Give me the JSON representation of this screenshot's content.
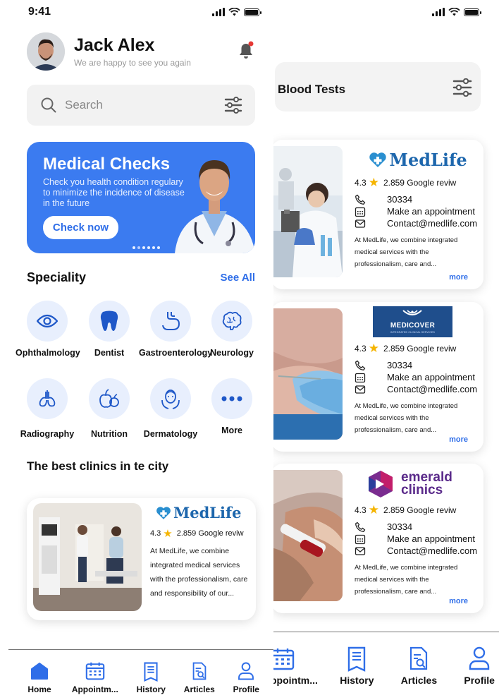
{
  "status": {
    "time": "9:41"
  },
  "user": {
    "name": "Jack Alex",
    "greeting": "We are happy to see you again"
  },
  "search": {
    "placeholder": "Search"
  },
  "banner": {
    "title": "Medical Checks",
    "text": "Check you health condition regulary to minimize the incidence of disease in the future",
    "button": "Check now",
    "dots_total": 6,
    "dots_active": 2
  },
  "speciality": {
    "title": "Speciality",
    "see_all": "See All",
    "items": [
      {
        "label": "Ophthalmology",
        "icon": "eye-icon"
      },
      {
        "label": "Dentist",
        "icon": "tooth-icon"
      },
      {
        "label": "Gastroenterology",
        "icon": "stomach-icon"
      },
      {
        "label": "Neurology",
        "icon": "brain-icon"
      },
      {
        "label": "Radiography",
        "icon": "lungs-icon"
      },
      {
        "label": "Nutrition",
        "icon": "fruit-icon"
      },
      {
        "label": "Dermatology",
        "icon": "face-skin-icon"
      },
      {
        "label": "More",
        "icon": "more-icon"
      }
    ]
  },
  "best_clinics": {
    "title": "The best clinics in te city",
    "card": {
      "name": "MedLife",
      "rating": "4.3",
      "reviews": "2.859 Google reviw",
      "description": "At MedLife, we combine integrated medical services with the professionalism, care and responsibility of our..."
    }
  },
  "nav_left": [
    {
      "label": "Home",
      "icon": "home-icon",
      "active": true
    },
    {
      "label": "Appointm...",
      "icon": "calendar-icon"
    },
    {
      "label": "History",
      "icon": "history-icon"
    },
    {
      "label": "Articles",
      "icon": "articles-icon"
    },
    {
      "label": "Profile",
      "icon": "profile-icon"
    }
  ],
  "blood_tests": {
    "title": "Blood Tests",
    "clinics": [
      {
        "name": "MedLife",
        "rating": "4.3",
        "reviews": "2.859 Google reviw",
        "phone": "30334",
        "appointment": "Make an appointment",
        "email": "Contact@medlife.com",
        "description": "At MedLife, we combine integrated medical services with the professionalism, care and...",
        "more": "more"
      },
      {
        "name": "MEDICOVER",
        "tagline": "INTEGRATED CLINICAL SERVICES",
        "rating": "4.3",
        "reviews": "2.859 Google reviw",
        "phone": "30334",
        "appointment": "Make an appointment",
        "email": "Contact@medlife.com",
        "description": "At MedLife, we combine integrated medical services with the professionalism, care and...",
        "more": "more"
      },
      {
        "name_line1": "emerald",
        "name_line2": "clinics",
        "rating": "4.3",
        "reviews": "2.859 Google reviw",
        "phone": "30334",
        "appointment": "Make an appointment",
        "email": "Contact@medlife.com",
        "description": "At MedLife, we combine integrated medical services with the professionalism, care and...",
        "more": "more"
      }
    ]
  },
  "nav_right": [
    {
      "label": "ppointm...",
      "icon": "calendar-icon"
    },
    {
      "label": "History",
      "icon": "history-icon"
    },
    {
      "label": "Articles",
      "icon": "articles-icon"
    },
    {
      "label": "Profile",
      "icon": "profile-icon"
    }
  ],
  "colors": {
    "primary": "#3B7BF0",
    "accent_blue": "#2F6EE8",
    "star": "#F5B400",
    "notification": "#E53935"
  }
}
